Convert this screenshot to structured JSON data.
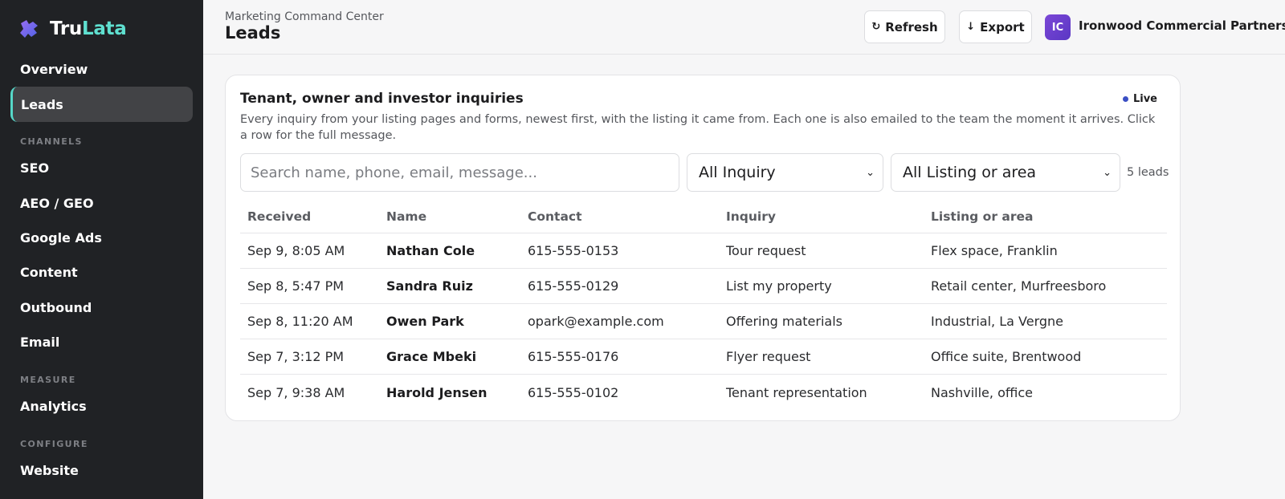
{
  "brand": {
    "part1": "Tru",
    "part2": "Lata",
    "accent": "#5fe0d0"
  },
  "sidebar": {
    "items": [
      {
        "label": "Overview"
      },
      {
        "label": "Leads",
        "active": true
      },
      {
        "label": "SEO"
      },
      {
        "label": "AEO / GEO"
      },
      {
        "label": "Google Ads"
      },
      {
        "label": "Content"
      },
      {
        "label": "Outbound"
      },
      {
        "label": "Email"
      },
      {
        "label": "Analytics"
      },
      {
        "label": "Website"
      }
    ],
    "sections": {
      "channels": "CHANNELS",
      "measure": "MEASURE",
      "configure": "CONFIGURE"
    }
  },
  "header": {
    "eyebrow": "Marketing Command Center",
    "title": "Leads",
    "refresh_label": "Refresh",
    "export_label": "Export",
    "avatar_initials": "IC",
    "org_name": "Ironwood Commercial Partners"
  },
  "card": {
    "title": "Tenant, owner and investor inquiries",
    "live_label": "Live",
    "description": "Every inquiry from your listing pages and forms, newest first, with the listing it came from. Each one is also emailed to the team the moment it arrives. Click a row for the full message.",
    "search_placeholder": "Search name, phone, email, message...",
    "inquiry_filter": "All Inquiry",
    "listing_filter": "All Listing or area",
    "count": "5 leads"
  },
  "table": {
    "headers": [
      "Received",
      "Name",
      "Contact",
      "Inquiry",
      "Listing or area"
    ],
    "rows": [
      [
        "Sep 9, 8:05 AM",
        "Nathan Cole",
        "615-555-0153",
        "Tour request",
        "Flex space, Franklin"
      ],
      [
        "Sep 8, 5:47 PM",
        "Sandra Ruiz",
        "615-555-0129",
        "List my property",
        "Retail center, Murfreesboro"
      ],
      [
        "Sep 8, 11:20 AM",
        "Owen Park",
        "opark@example.com",
        "Offering materials",
        "Industrial, La Vergne"
      ],
      [
        "Sep 7, 3:12 PM",
        "Grace Mbeki",
        "615-555-0176",
        "Flyer request",
        "Office suite, Brentwood"
      ],
      [
        "Sep 7, 9:38 AM",
        "Harold Jensen",
        "615-555-0102",
        "Tenant representation",
        "Nashville, office"
      ]
    ]
  },
  "icons": {
    "logo": "puzzle-logo-icon",
    "refresh": "refresh-icon",
    "export": "download-arrow-icon",
    "chevron": "chevron-down-icon",
    "live": "live-dot-icon"
  }
}
